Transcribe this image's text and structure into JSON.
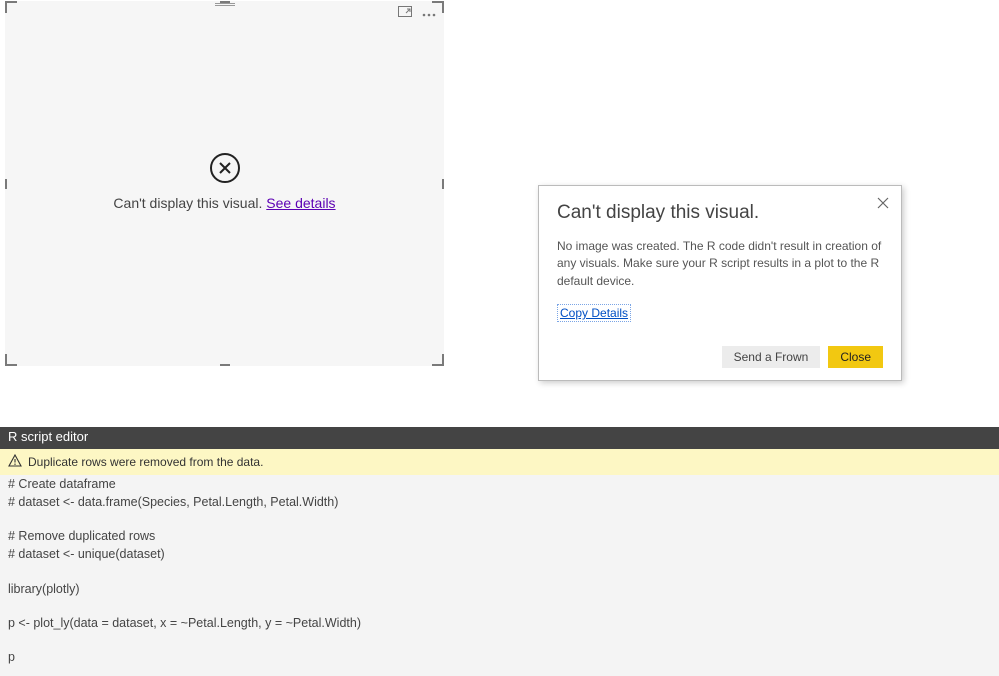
{
  "visual": {
    "error_message": "Can't display this visual. ",
    "see_details": "See details"
  },
  "dialog": {
    "title": "Can't display this visual.",
    "body": "No image was created. The R code didn't result in creation of any visuals. Make sure your R script results in a plot to the R default device.",
    "copy_details": "Copy Details",
    "send_frown": "Send a Frown",
    "close": "Close"
  },
  "editor": {
    "title": "R script editor",
    "warning": "Duplicate rows were removed from the data.",
    "code": [
      "# Create dataframe",
      "# dataset <- data.frame(Species, Petal.Length, Petal.Width)",
      "",
      "# Remove duplicated rows",
      "# dataset <- unique(dataset)",
      "",
      "library(plotly)",
      "",
      "p <- plot_ly(data = dataset, x = ~Petal.Length, y = ~Petal.Width)",
      "",
      "p"
    ]
  }
}
